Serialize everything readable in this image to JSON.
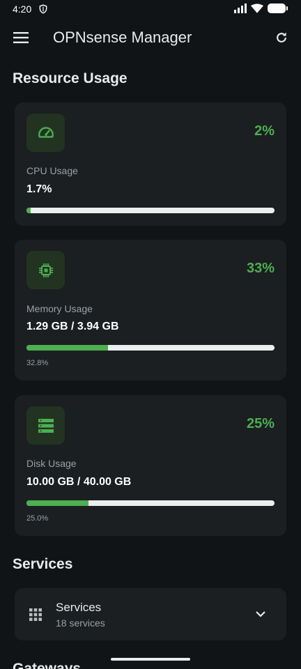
{
  "status_bar": {
    "time": "4:20",
    "icons": [
      "shield-icon",
      "signal-icon",
      "wifi-icon",
      "battery-icon"
    ]
  },
  "app_bar": {
    "title": "OPNsense Manager",
    "icons": [
      "menu-icon",
      "refresh-icon"
    ]
  },
  "resource_section": {
    "title": "Resource Usage",
    "cards": [
      {
        "icon": "speedometer-icon",
        "percent": "2%",
        "label": "CPU Usage",
        "value": "1.7%",
        "progress": 0.017,
        "sub": ""
      },
      {
        "icon": "memory-chip-icon",
        "percent": "33%",
        "label": "Memory Usage",
        "value": "1.29 GB / 3.94 GB",
        "progress": 0.328,
        "sub": "32.8%"
      },
      {
        "icon": "storage-icon",
        "percent": "25%",
        "label": "Disk Usage",
        "value": "10.00 GB / 40.00 GB",
        "progress": 0.25,
        "sub": "25.0%"
      }
    ]
  },
  "services_section": {
    "title": "Services",
    "card": {
      "icon": "apps-grid-icon",
      "title": "Services",
      "count": "18 services",
      "expand_icon": "chevron-down-icon"
    }
  },
  "gateways_section": {
    "title": "Gateways"
  },
  "colors": {
    "accent": "#4caf50",
    "background": "#111416",
    "card": "#1b1f21"
  }
}
